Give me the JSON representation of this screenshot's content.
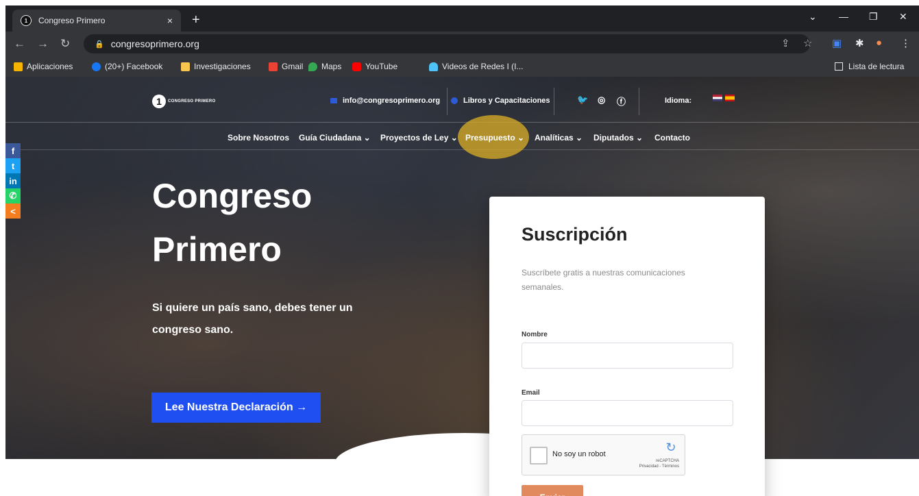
{
  "browser": {
    "tab_title": "Congreso Primero",
    "tab_close": "×",
    "new_tab": "+",
    "url": "congresoprimero.org",
    "bookmarks": [
      {
        "label": "Aplicaciones",
        "color": "#f4b400"
      },
      {
        "label": "(20+) Facebook",
        "color": "#1877f2"
      },
      {
        "label": "Investigaciones",
        "color": "#f9c74f"
      },
      {
        "label": "Gmail",
        "color": "#ea4335"
      },
      {
        "label": "Maps",
        "color": "#34a853"
      },
      {
        "label": "YouTube",
        "color": "#ff0000"
      },
      {
        "label": "Videos de Redes I (I...",
        "color": "#4fc3f7"
      }
    ],
    "reading_list": "Lista de lectura"
  },
  "site": {
    "logo_text": "CONGRESO PRIMERO",
    "logo_mark": "1",
    "email": "info@congresoprimero.org",
    "books": "Libros y Capacitaciones",
    "language_label": "Idioma:",
    "menu": [
      "Sobre Nosotros",
      "Guía Ciudadana ⌄",
      "Proyectos de Ley ⌄",
      "Presupuesto ⌄",
      "Analíticas ⌄",
      "Diputados ⌄",
      "Contacto"
    ],
    "hero_title_line1": "Congreso",
    "hero_title_line2": "Primero",
    "hero_subtitle": "Si quiere un país sano, debes tener un congreso sano.",
    "cta_label": "Lee Nuestra Declaración →",
    "share_colors": [
      "#3b5998",
      "#1da1f2",
      "#0077b5",
      "#25d366",
      "#f47d20"
    ]
  },
  "form": {
    "title": "Suscripción",
    "description": "Suscríbete gratis a nuestras comunicaciones semanales.",
    "name_label": "Nombre",
    "email_label": "Email",
    "captcha_label": "No soy un robot",
    "captcha_brand": "reCAPTCHA",
    "captcha_terms": "Privacidad - Términos",
    "submit_label": "Enviar"
  }
}
